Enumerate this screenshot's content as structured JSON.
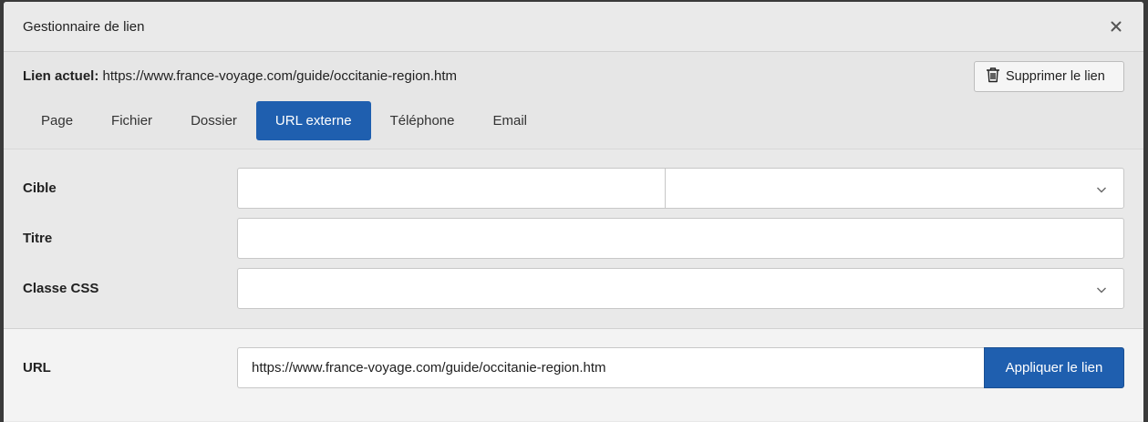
{
  "dialog": {
    "title": "Gestionnaire de lien",
    "close_icon": "close-icon"
  },
  "current_link": {
    "label": "Lien actuel:",
    "value": "https://www.france-voyage.com/guide/occitanie-region.htm",
    "remove_label": "Supprimer le lien",
    "remove_icon": "trash-icon"
  },
  "tabs": [
    {
      "label": "Page",
      "active": false
    },
    {
      "label": "Fichier",
      "active": false
    },
    {
      "label": "Dossier",
      "active": false
    },
    {
      "label": "URL externe",
      "active": true
    },
    {
      "label": "Téléphone",
      "active": false
    },
    {
      "label": "Email",
      "active": false
    }
  ],
  "form": {
    "target_label": "Cible",
    "target_value": "",
    "target_select_value": "",
    "title_label": "Titre",
    "title_value": "",
    "css_class_label": "Classe CSS",
    "css_class_value": ""
  },
  "url": {
    "label": "URL",
    "value": "https://www.france-voyage.com/guide/occitanie-region.htm",
    "apply_label": "Appliquer le lien"
  },
  "colors": {
    "accent": "#1f5faf"
  }
}
